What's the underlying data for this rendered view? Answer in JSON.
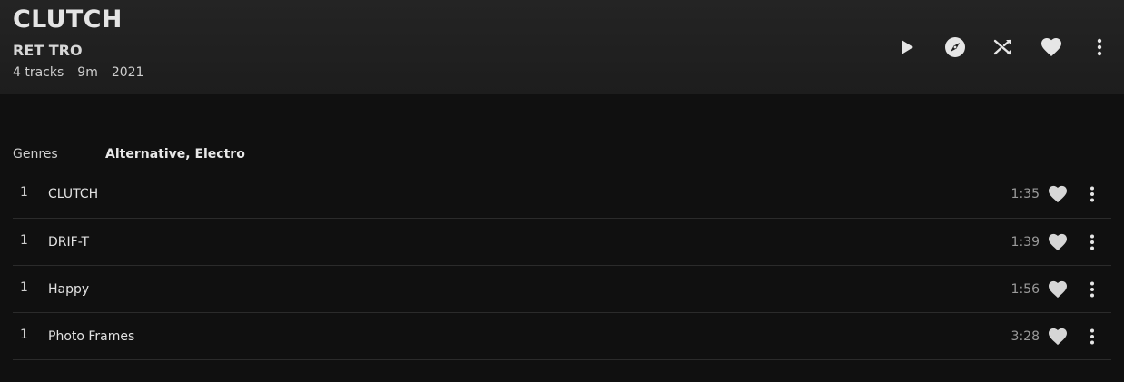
{
  "album": {
    "title": "CLUTCH",
    "artist": "RET TRO",
    "track_count": "4 tracks",
    "duration": "9m",
    "year": "2021"
  },
  "actions": {
    "play_icon": "play-icon",
    "radio_icon": "compass-icon",
    "shuffle_icon": "shuffle-icon",
    "favorite_icon": "heart-icon",
    "more_icon": "more-vertical-icon"
  },
  "genres": {
    "label": "Genres",
    "value": "Alternative, Electro"
  },
  "tracks": [
    {
      "number": "1",
      "title": "CLUTCH",
      "duration": "1:35"
    },
    {
      "number": "1",
      "title": "DRIF-T",
      "duration": "1:39"
    },
    {
      "number": "1",
      "title": "Happy",
      "duration": "1:56"
    },
    {
      "number": "1",
      "title": "Photo Frames",
      "duration": "3:28"
    }
  ],
  "colors": {
    "background": "#101010",
    "header": "#222222",
    "icon": "#e6e6e6",
    "divider": "#2b2b2b"
  }
}
